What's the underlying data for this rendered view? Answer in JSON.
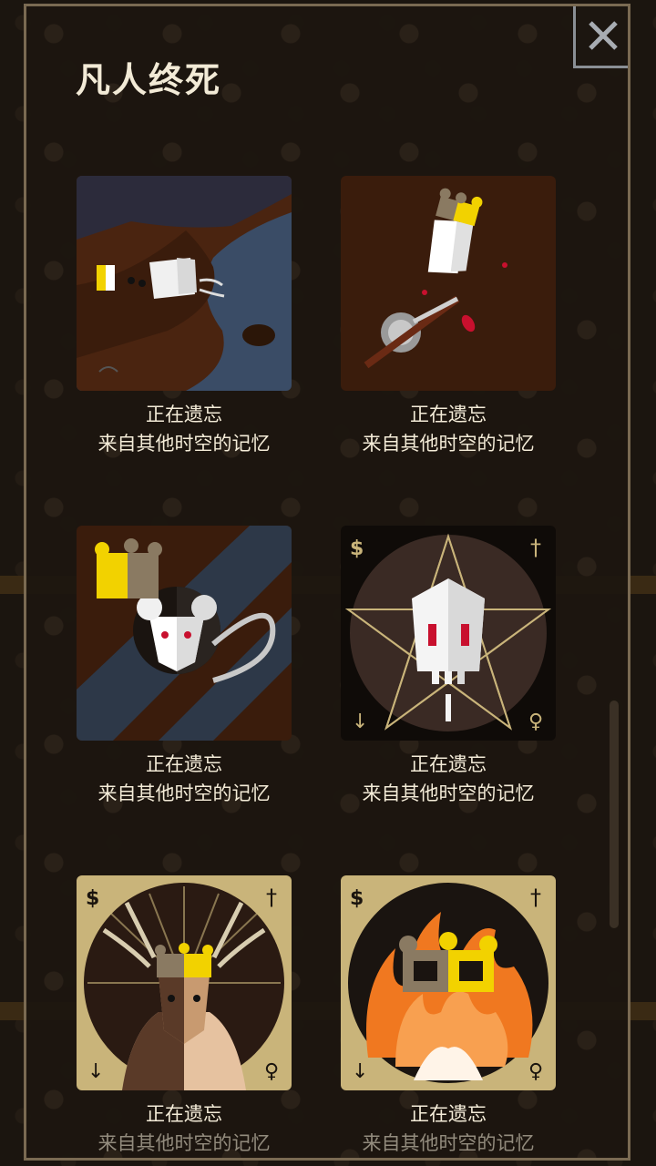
{
  "dialog": {
    "title": "凡人终死",
    "close_icon": "close-x-icon"
  },
  "cards": [
    {
      "line1": "正在遗忘",
      "line2": "来自其他时空的记忆",
      "art": "drowned-king-river"
    },
    {
      "line1": "正在遗忘",
      "line2": "来自其他时空的记忆",
      "art": "king-stabbed-sword"
    },
    {
      "line1": "正在遗忘",
      "line2": "来自其他时空的记忆",
      "art": "rat-king"
    },
    {
      "line1": "正在遗忘",
      "line2": "来自其他时空的记忆",
      "art": "skull-pentagram",
      "corner_icons": [
        "$",
        "†",
        "↓",
        "figure"
      ]
    },
    {
      "line1": "正在遗忘",
      "line2": "来自其他时空的记忆",
      "art": "crowned-stag",
      "corner_icons": [
        "$",
        "†",
        "↓",
        "figure"
      ]
    },
    {
      "line1": "正在遗忘",
      "line2": "来自其他时空的记忆",
      "art": "crown-in-fire",
      "corner_icons": [
        "$",
        "†",
        "↓",
        "figure"
      ]
    }
  ],
  "colors": {
    "background": "#1b150f",
    "panel_border": "#7a6a52",
    "text": "#f4ecd8",
    "gold": "#c9b47a",
    "crown_yellow": "#f2d200"
  }
}
